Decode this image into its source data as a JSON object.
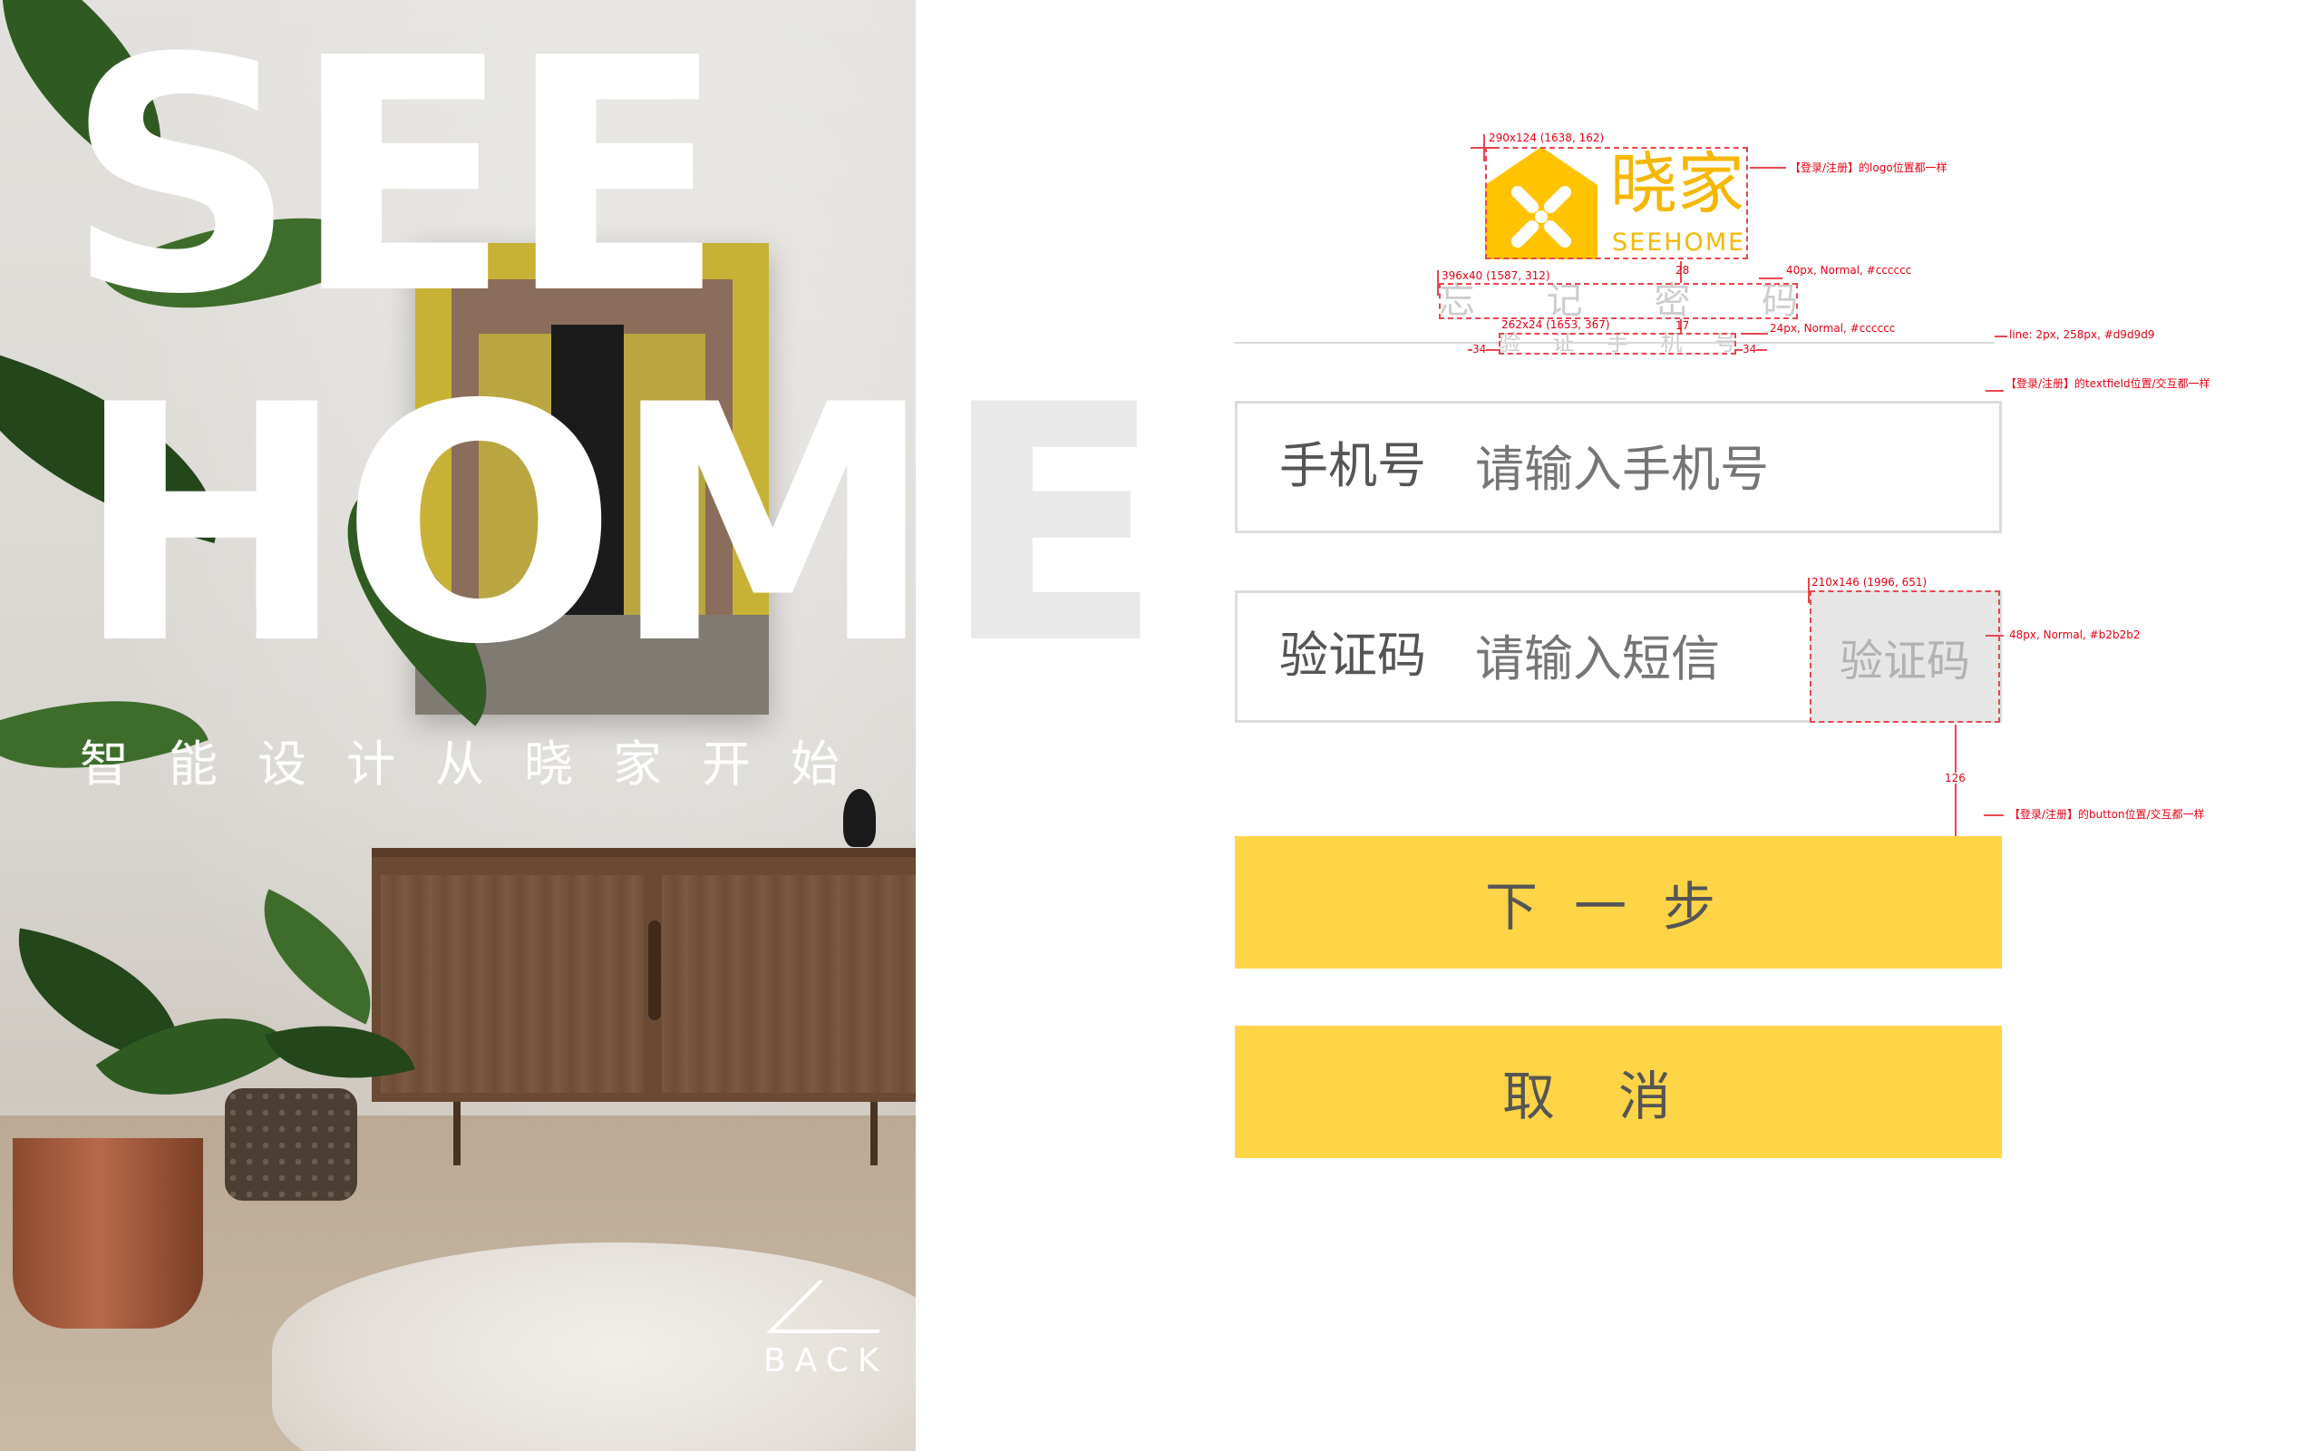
{
  "hero": {
    "line1": "SEE",
    "line2": "HOM",
    "line2_overflow": "E",
    "slogan": "智能设计从晓家开始",
    "back_label": "BACK"
  },
  "logo": {
    "brand_cn": "晓家",
    "brand_en": "SEEHOME",
    "color": "#f5b700"
  },
  "header": {
    "title_chars": [
      "忘",
      "记",
      "密",
      "码"
    ],
    "subtitle_chars": [
      "验",
      "证",
      "手",
      "机",
      "号"
    ]
  },
  "form": {
    "phone_label": "手机号",
    "phone_placeholder": "请输入手机号",
    "code_label": "验证码",
    "code_placeholder": "请输入短信",
    "code_button": "验证码",
    "next_button": "下一步",
    "cancel_button": "取消",
    "button_color": "#ffd447"
  },
  "annotations": {
    "logo_size": "290x124 (1638, 162)",
    "logo_note": "【登录/注册】的logo位置都一样",
    "gap_logo_title": "28",
    "title_size": "396x40 (1587, 312)",
    "title_font": "40px, Normal, #cccccc",
    "subtitle_size": "262x24 (1653, 367)",
    "gap_title_subtitle": "17",
    "subtitle_font": "24px, Normal, #cccccc",
    "side_gap_left": "34",
    "side_gap_right": "34",
    "line_note": "line: 2px, 258px, #d9d9d9",
    "textfield_note": "【登录/注册】的textfield位置/交互都一样",
    "code_btn_size": "210x146 (1996, 651)",
    "code_btn_font": "48px, Normal, #b2b2b2",
    "gap_to_button": "126",
    "button_note": "【登录/注册】的button位置/交互都一样"
  }
}
